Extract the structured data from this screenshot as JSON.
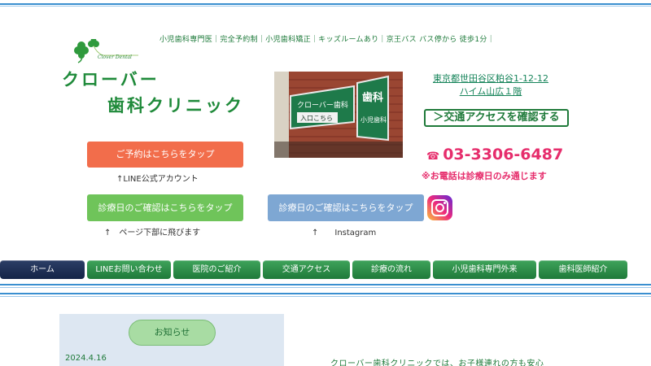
{
  "header": {
    "tagline": "小児歯科専門医｜完全予約制｜小児歯科矯正｜キッズルームあり｜京王バス バス停から 徒歩1分｜",
    "logo_text": "Clover Dental",
    "clinic_name_line1": "クローバー",
    "clinic_name_line2": "歯科クリニック"
  },
  "photo": {
    "sign_main": "クローバー歯科",
    "sign_entrance": "入口こちら",
    "sign_vertical_1": "歯科",
    "sign_vertical_2": "小児歯科"
  },
  "contact": {
    "address_line1": "東京都世田谷区粕谷1-12-12",
    "address_line2": "ハイム山広１階",
    "access_button": "＞交通アクセスを確認する",
    "phone_icon": "☎",
    "phone": "03-3306-6487",
    "phone_note": "※お電話は診療日のみ通じます"
  },
  "actions": {
    "reserve_button": "ご予約はこちらをタップ",
    "reserve_note": "↑LINE公式アカウント",
    "days_button_1": "診療日のご確認はこちらをタップ",
    "days_note_1": "↑　ページ下部に飛びます",
    "days_button_2": "診療日のご確認はこちらをタップ",
    "days_note_2": "↑　　Instagram"
  },
  "nav": {
    "items": [
      {
        "label": "ホーム"
      },
      {
        "label": "LINEお問い合わせ"
      },
      {
        "label": "医院のご紹介"
      },
      {
        "label": "交通アクセス"
      },
      {
        "label": "診療の流れ"
      },
      {
        "label": "小児歯科専門外来"
      },
      {
        "label": "歯科医師紹介"
      }
    ]
  },
  "news": {
    "button": "お知らせ",
    "date": "2024.4.16"
  },
  "intro": {
    "text": "クローバー歯科クリニックでは、お子様連れの方も安心"
  },
  "colors": {
    "brand_green": "#1f8a3a",
    "accent_pink": "#e62d6c",
    "reserve_orange": "#f26d4b",
    "nav_active": "#142447"
  }
}
